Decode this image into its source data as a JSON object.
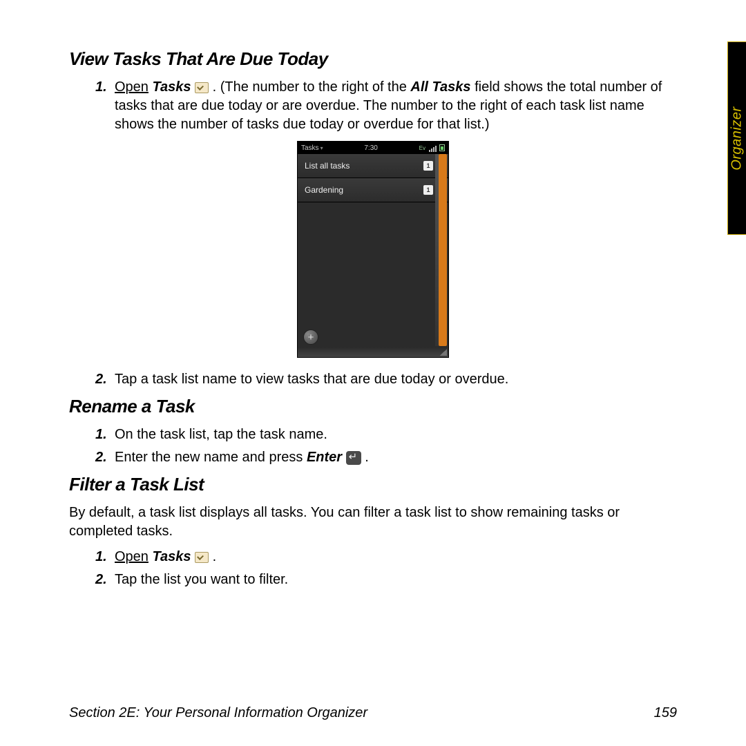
{
  "sideTab": "Organizer",
  "sections": {
    "viewTasks": {
      "heading": "View Tasks That Are Due Today",
      "step1_open": "Open",
      "step1_tasks": "Tasks",
      "step1_rest_a": ". (The number to the right of the ",
      "step1_allTasks": "All Tasks",
      "step1_rest_b": " field shows the total number of tasks that are due today or are overdue. The number to the right of each task list name shows the number of tasks due today or overdue for that list.)",
      "step2": "Tap a task list name to view tasks that are due today or overdue."
    },
    "rename": {
      "heading": "Rename a Task",
      "step1": "On the task list, tap the task name.",
      "step2_a": "Enter the new name and press ",
      "step2_enter": "Enter",
      "step2_b": "."
    },
    "filter": {
      "heading": "Filter a Task List",
      "intro": "By default, a task list displays all tasks. You can filter a task list to show remaining tasks or completed tasks.",
      "step1_open": "Open",
      "step1_tasks": "Tasks",
      "step1_rest": ".",
      "step2": "Tap the list you want to filter."
    }
  },
  "phone": {
    "appName": "Tasks",
    "time": "7:30",
    "row1_label": "List all tasks",
    "row1_count": "1",
    "row2_label": "Gardening",
    "row2_count": "1",
    "addSymbol": "+"
  },
  "footer": {
    "left": "Section 2E: Your Personal Information Organizer",
    "pageNum": "159"
  },
  "nums": {
    "n1": "1.",
    "n2": "2."
  }
}
